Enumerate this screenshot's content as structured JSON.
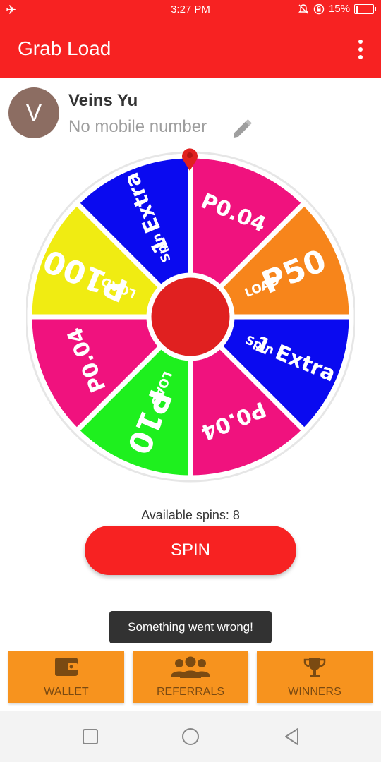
{
  "status_bar": {
    "time": "3:27 PM",
    "battery": "15%"
  },
  "app_bar": {
    "title": "Grab Load"
  },
  "profile": {
    "avatar_letter": "V",
    "name": "Veins Yu",
    "mobile": "No mobile number"
  },
  "wheel": {
    "segments": [
      {
        "main": "P0.04",
        "sub": "",
        "color": "#f0127e"
      },
      {
        "main": "P50",
        "sub": "LOAD",
        "color": "#f7851b"
      },
      {
        "main": "1 Extra",
        "sub": "Spin",
        "color": "#0a0af0"
      },
      {
        "main": "P0.04",
        "sub": "",
        "color": "#f0127e"
      },
      {
        "main": "P10",
        "sub": "LOAD",
        "color": "#1ef01e"
      },
      {
        "main": "P0.04",
        "sub": "",
        "color": "#f0127e"
      },
      {
        "main": "P100",
        "sub": "LOAD",
        "color": "#f0ec12"
      },
      {
        "main": "1 Extra",
        "sub": "Spin",
        "color": "#0a0af0"
      }
    ],
    "hub_color": "#e02020"
  },
  "spins_text": "Available spins: 8",
  "spin_button": "SPIN",
  "toast": "Something went wrong!",
  "tabs": [
    {
      "label": "WALLET",
      "icon": "wallet-icon"
    },
    {
      "label": "REFERRALS",
      "icon": "group-icon"
    },
    {
      "label": "WINNERS",
      "icon": "trophy-icon"
    }
  ],
  "nav_bar": {
    "icons": [
      "square-recents-icon",
      "circle-home-icon",
      "triangle-back-icon"
    ]
  }
}
